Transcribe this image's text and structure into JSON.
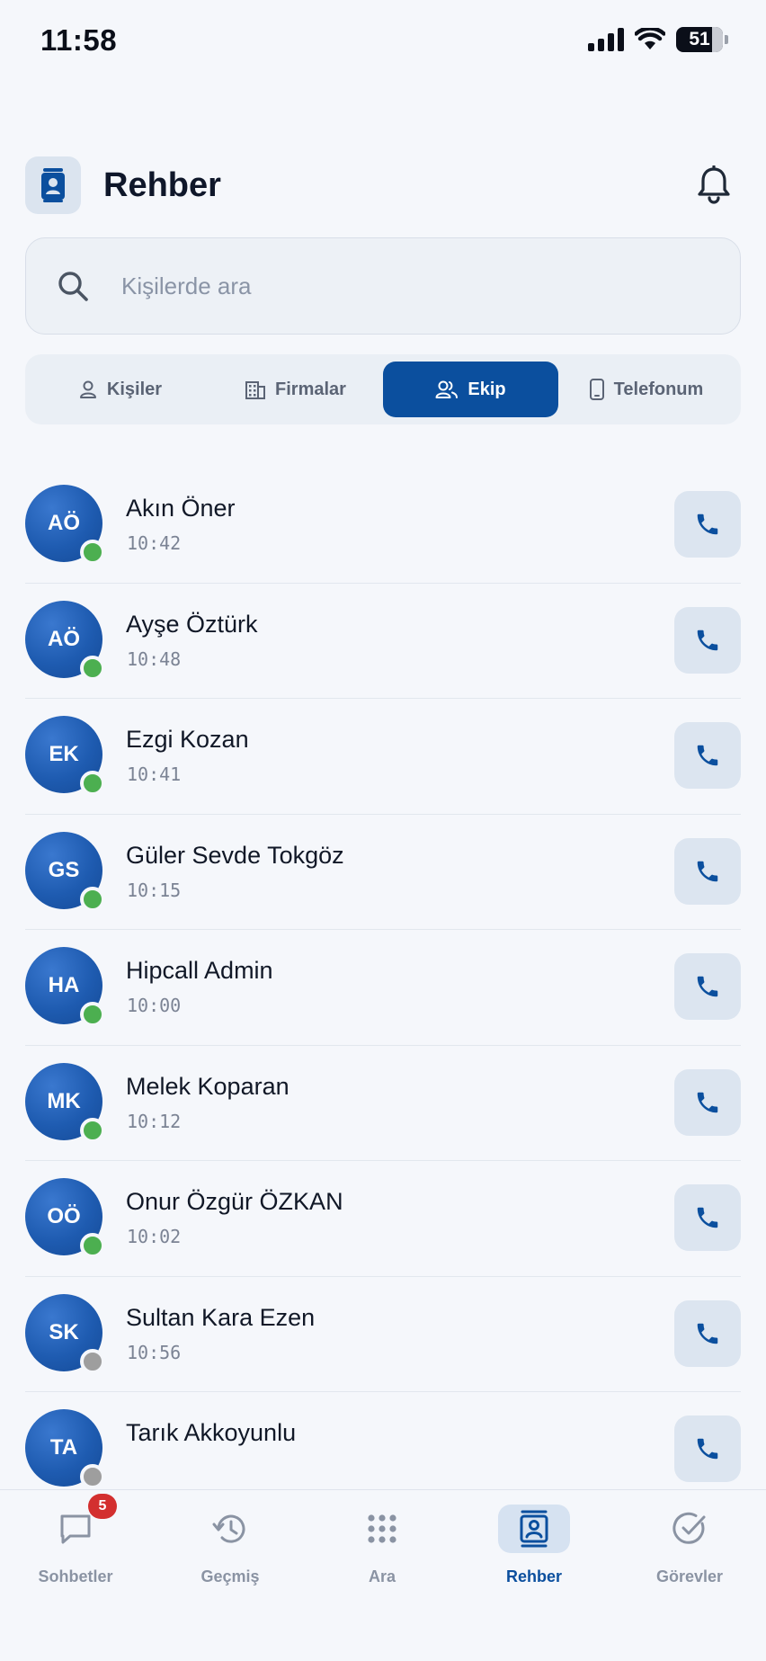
{
  "status_bar": {
    "time": "11:58",
    "battery": "51"
  },
  "header": {
    "title": "Rehber"
  },
  "search": {
    "placeholder": "Kişilerde ara"
  },
  "tabs": [
    {
      "label": "Kişiler",
      "icon": "person-icon",
      "active": false
    },
    {
      "label": "Firmalar",
      "icon": "building-icon",
      "active": false
    },
    {
      "label": "Ekip",
      "icon": "team-icon",
      "active": true
    },
    {
      "label": "Telefonum",
      "icon": "phone-device-icon",
      "active": false
    }
  ],
  "contacts": [
    {
      "initials": "AÖ",
      "name": "Akın Öner",
      "time": "10:42",
      "status": "online"
    },
    {
      "initials": "AÖ",
      "name": "Ayşe Öztürk",
      "time": "10:48",
      "status": "online"
    },
    {
      "initials": "EK",
      "name": "Ezgi Kozan",
      "time": "10:41",
      "status": "online"
    },
    {
      "initials": "GS",
      "name": "Güler Sevde Tokgöz",
      "time": "10:15",
      "status": "online"
    },
    {
      "initials": "HA",
      "name": "Hipcall Admin",
      "time": "10:00",
      "status": "online"
    },
    {
      "initials": "MK",
      "name": "Melek Koparan",
      "time": "10:12",
      "status": "online"
    },
    {
      "initials": "OÖ",
      "name": "Onur Özgür ÖZKAN",
      "time": "10:02",
      "status": "online"
    },
    {
      "initials": "SK",
      "name": "Sultan Kara Ezen",
      "time": "10:56",
      "status": "offline"
    },
    {
      "initials": "TA",
      "name": "Tarık Akkoyunlu",
      "time": "",
      "status": "offline"
    }
  ],
  "bottom_nav": [
    {
      "label": "Sohbetler",
      "icon": "chat-icon",
      "badge": "5",
      "active": false
    },
    {
      "label": "Geçmiş",
      "icon": "history-icon",
      "active": false
    },
    {
      "label": "Ara",
      "icon": "dialpad-icon",
      "active": false
    },
    {
      "label": "Rehber",
      "icon": "contacts-book-icon",
      "active": true
    },
    {
      "label": "Görevler",
      "icon": "check-circle-icon",
      "active": false
    }
  ],
  "colors": {
    "primary": "#0b4f9e",
    "avatar": "#1e5bb0",
    "online": "#4caf50",
    "offline": "#9e9e9e",
    "badge": "#d32f2f",
    "background": "#f5f7fb"
  }
}
